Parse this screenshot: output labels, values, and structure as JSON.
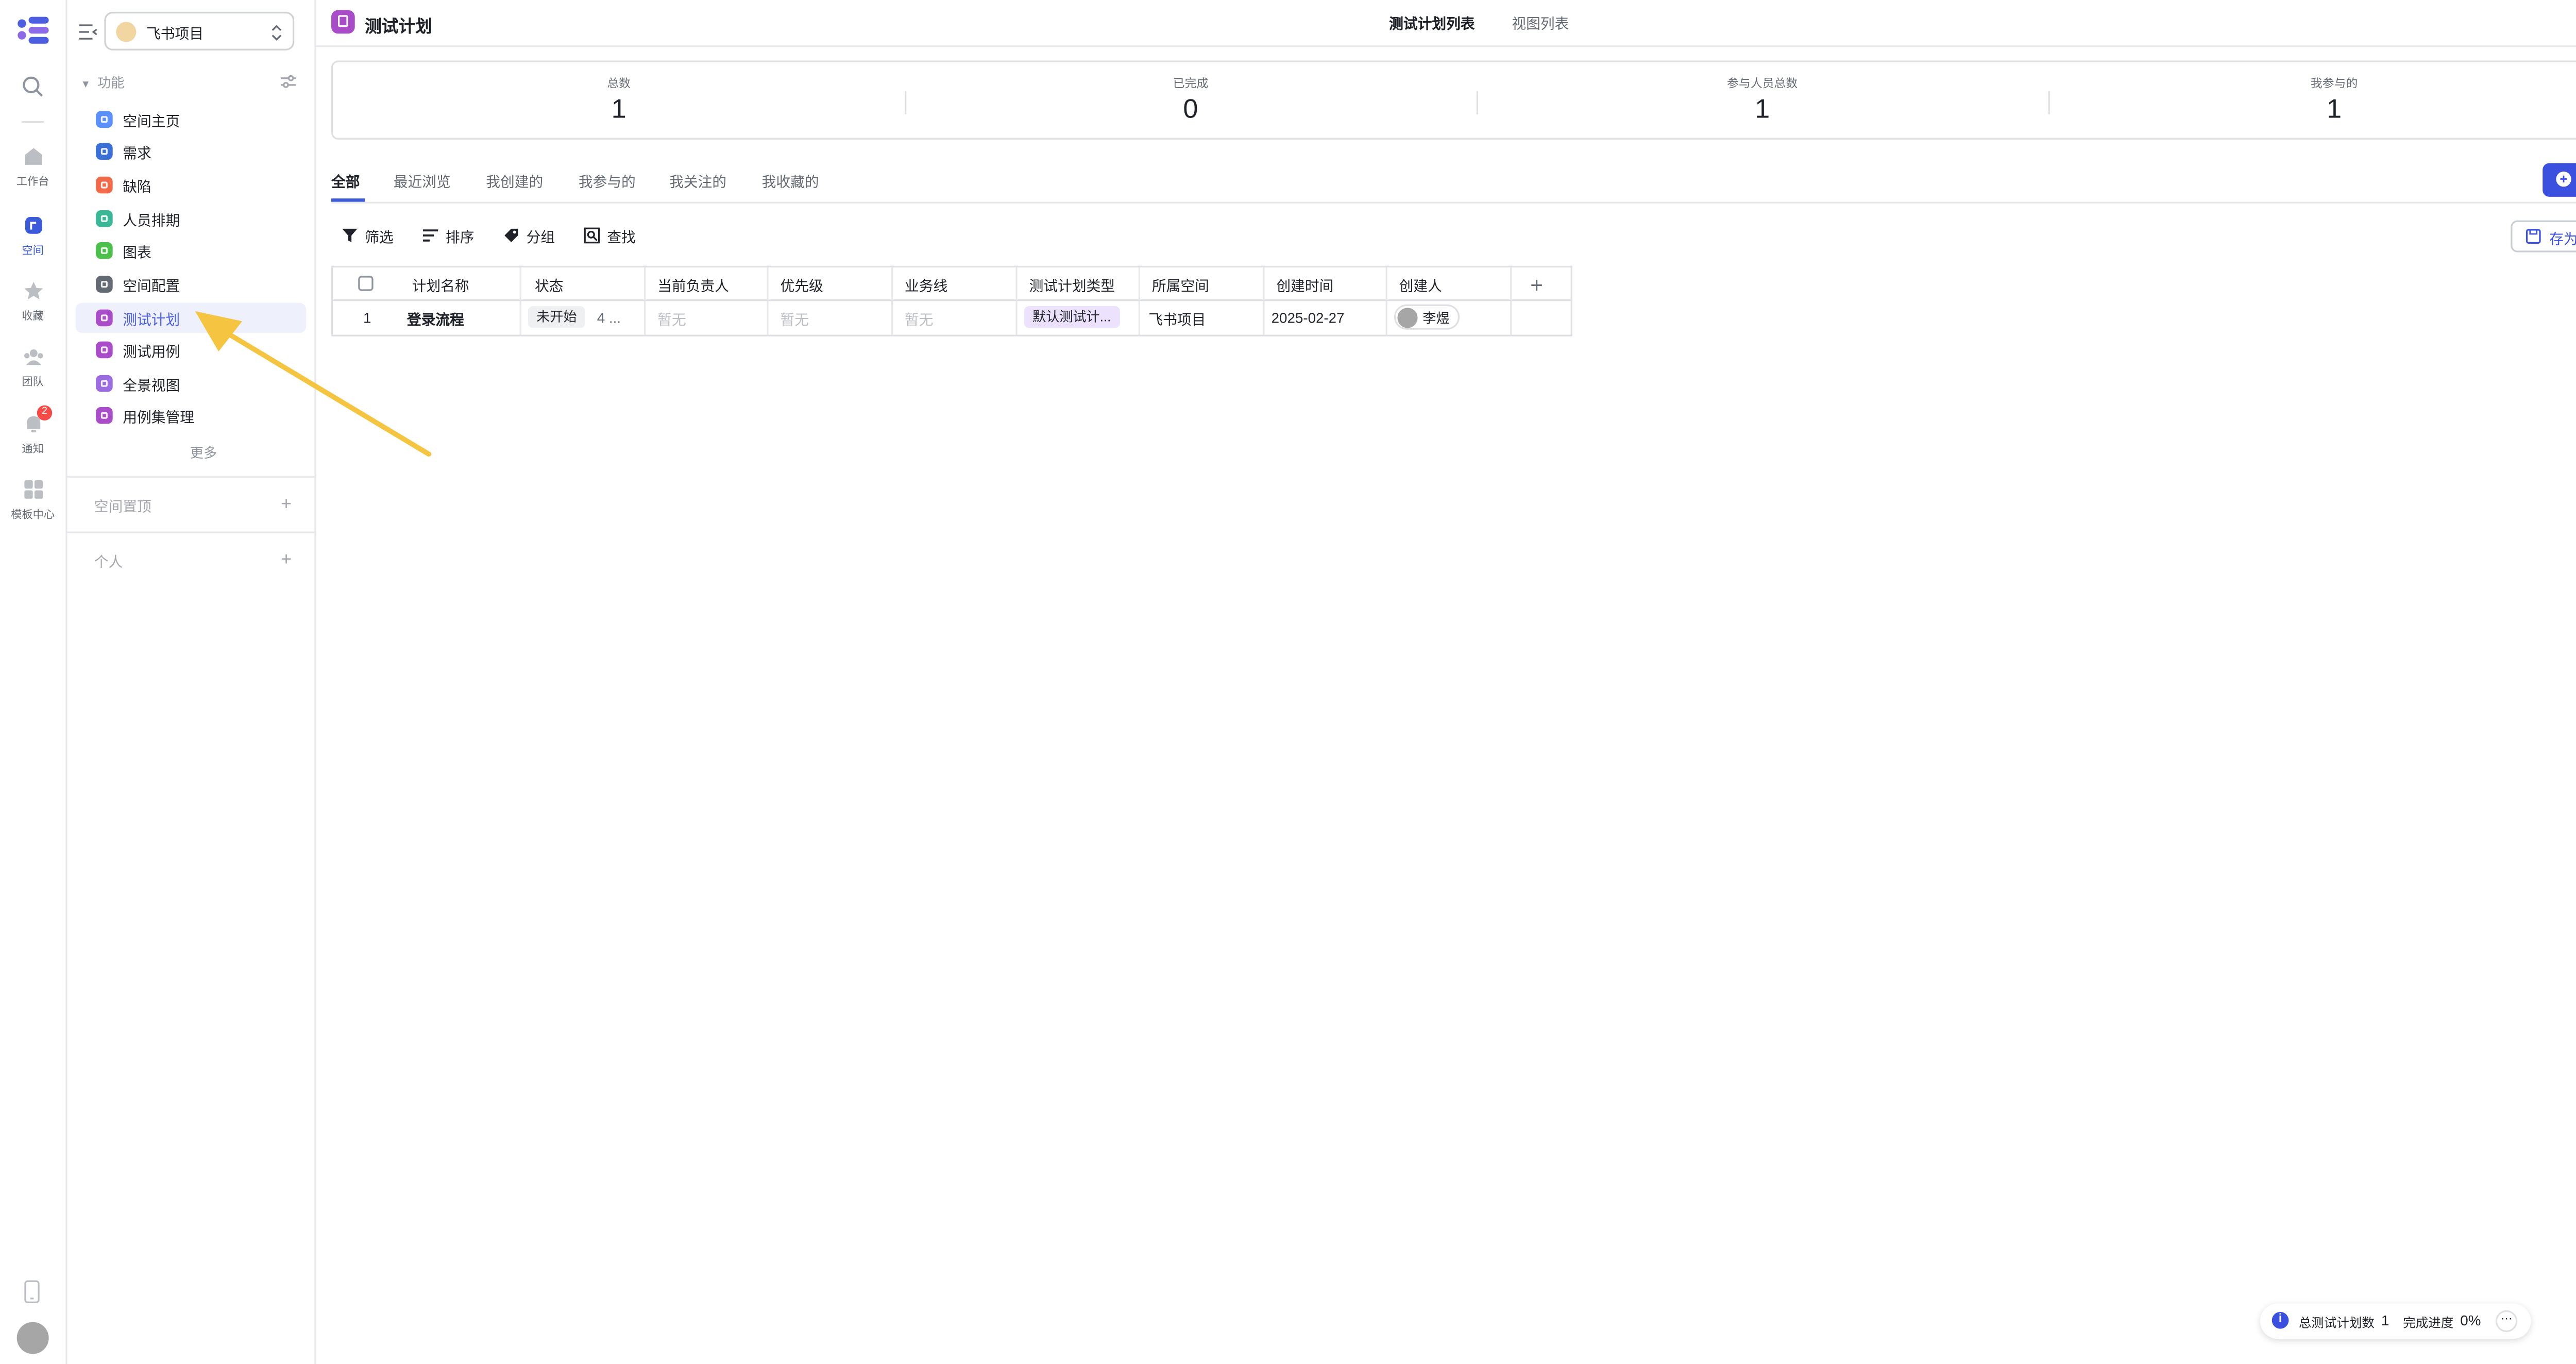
{
  "rail": {
    "items": [
      {
        "label": "工作台",
        "icon": "home-icon"
      },
      {
        "label": "空间",
        "icon": "space-icon",
        "active": true
      },
      {
        "label": "收藏",
        "icon": "star-icon"
      },
      {
        "label": "团队",
        "icon": "team-icon"
      },
      {
        "label": "通知",
        "icon": "bell-icon",
        "badge": "2"
      },
      {
        "label": "模板中心",
        "icon": "template-icon"
      }
    ]
  },
  "sidebar": {
    "project_name": "飞书项目",
    "section_label": "功能",
    "items": [
      {
        "label": "空间主页",
        "color": "#5b8ff9"
      },
      {
        "label": "需求",
        "color": "#3b6fd8"
      },
      {
        "label": "缺陷",
        "color": "#f06a4a"
      },
      {
        "label": "人员排期",
        "color": "#3ab795"
      },
      {
        "label": "图表",
        "color": "#4cbf4c"
      },
      {
        "label": "空间配置",
        "color": "#646a73"
      },
      {
        "label": "测试计划",
        "color": "#a84cc7",
        "active": true
      },
      {
        "label": "测试用例",
        "color": "#a84cc7"
      },
      {
        "label": "全景视图",
        "color": "#9b6be0"
      },
      {
        "label": "用例集管理",
        "color": "#a84cc7"
      }
    ],
    "more_label": "更多",
    "pinned_label": "空间置顶",
    "personal_label": "个人"
  },
  "header": {
    "title": "测试计划",
    "tabs": [
      "测试计划列表",
      "视图列表"
    ]
  },
  "stats": [
    {
      "label": "总数",
      "value": "1"
    },
    {
      "label": "已完成",
      "value": "0"
    },
    {
      "label": "参与人员总数",
      "value": "1"
    },
    {
      "label": "我参与的",
      "value": "1"
    }
  ],
  "filter_tabs": [
    "全部",
    "最近浏览",
    "我创建的",
    "我参与的",
    "我关注的",
    "我收藏的"
  ],
  "new_button": "新建",
  "toolbar": {
    "filter": "筛选",
    "sort": "排序",
    "group": "分组",
    "find": "查找",
    "save_view": "存为视图"
  },
  "table": {
    "columns": [
      "计划名称",
      "状态",
      "当前负责人",
      "优先级",
      "业务线",
      "测试计划类型",
      "所属空间",
      "创建时间",
      "创建人"
    ],
    "rows": [
      {
        "index": "1",
        "name": "登录流程",
        "status": "未开始",
        "status_extra": "4 ...",
        "owner": "暂无",
        "priority": "暂无",
        "business": "暂无",
        "plan_type": "默认测试计...",
        "space": "飞书项目",
        "created_at": "2025-02-27",
        "creator": "李煜"
      }
    ]
  },
  "footer": {
    "total_label": "总测试计划数",
    "total_value": "1",
    "progress_label": "完成进度",
    "progress_value": "0%"
  },
  "colors": {
    "accent": "#3c50e0",
    "active_nav_bg": "#eef0fb",
    "arrow": "#f5c542"
  }
}
